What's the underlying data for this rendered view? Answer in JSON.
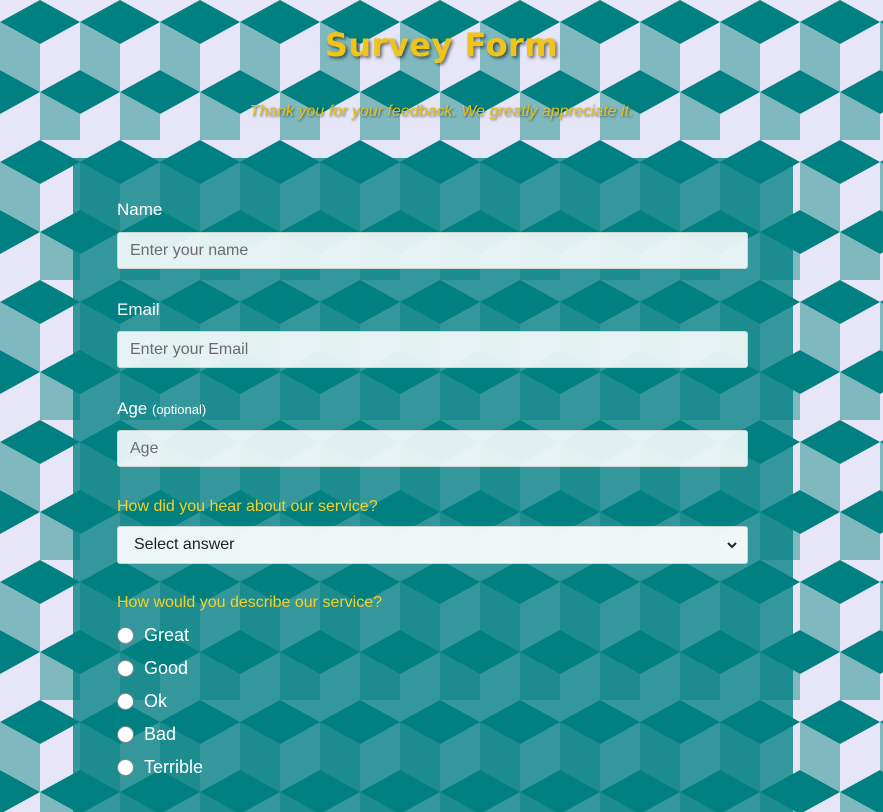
{
  "header": {
    "title": "Survey Form",
    "subtitle": "Thank you for your feedback. We greatly appreciate it."
  },
  "form": {
    "name": {
      "label": "Name",
      "placeholder": "Enter your name",
      "value": ""
    },
    "email": {
      "label": "Email",
      "placeholder": "Enter your Email",
      "value": ""
    },
    "age": {
      "label": "Age",
      "label_note": "(optional)",
      "placeholder": "Age",
      "value": ""
    },
    "referral": {
      "question": "How did you hear about our service?",
      "selected": "Select answer"
    },
    "rating": {
      "question": "How would you describe our service?",
      "options": [
        {
          "label": "Great",
          "checked": false
        },
        {
          "label": "Good",
          "checked": false
        },
        {
          "label": "Ok",
          "checked": false
        },
        {
          "label": "Bad",
          "checked": false
        },
        {
          "label": "Terrible",
          "checked": false
        }
      ]
    }
  },
  "colors": {
    "teal": "#008080",
    "teal_light": "#7fb8bf",
    "lavender": "#e7e6f8",
    "gold": "#f0c419"
  },
  "icons": {
    "select_arrow": "chevron-down-icon"
  }
}
